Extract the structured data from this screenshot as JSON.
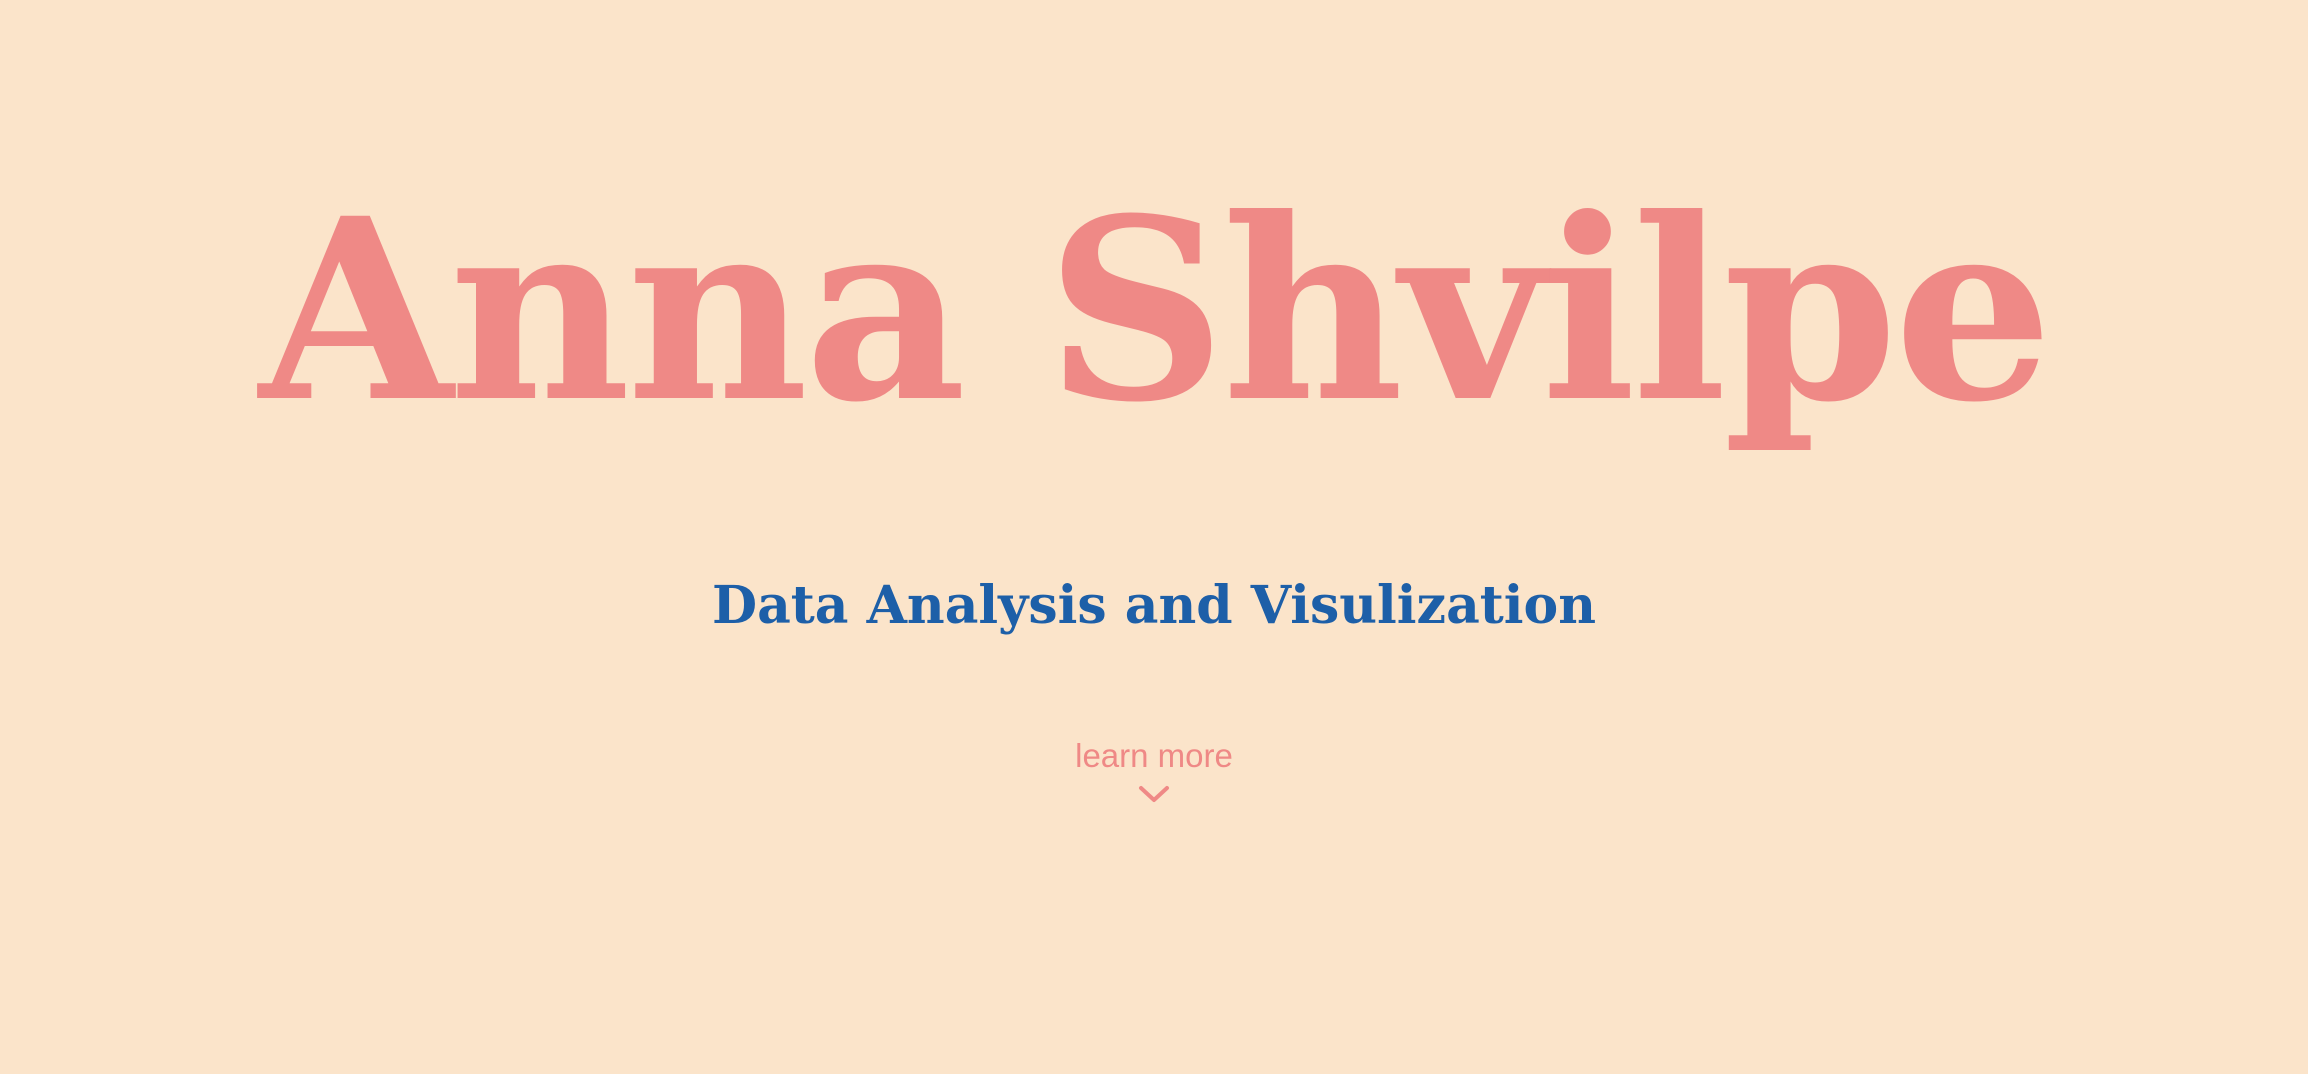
{
  "hero": {
    "name": "Anna Shvilpe",
    "subtitle": "Data Analysis and Visulization",
    "cta_label": "learn more",
    "cta_icon": "chevron-down-icon"
  },
  "colors": {
    "background": "#fbe4ca",
    "accent": "#ef8986",
    "subtitle": "#1d5fa8"
  }
}
